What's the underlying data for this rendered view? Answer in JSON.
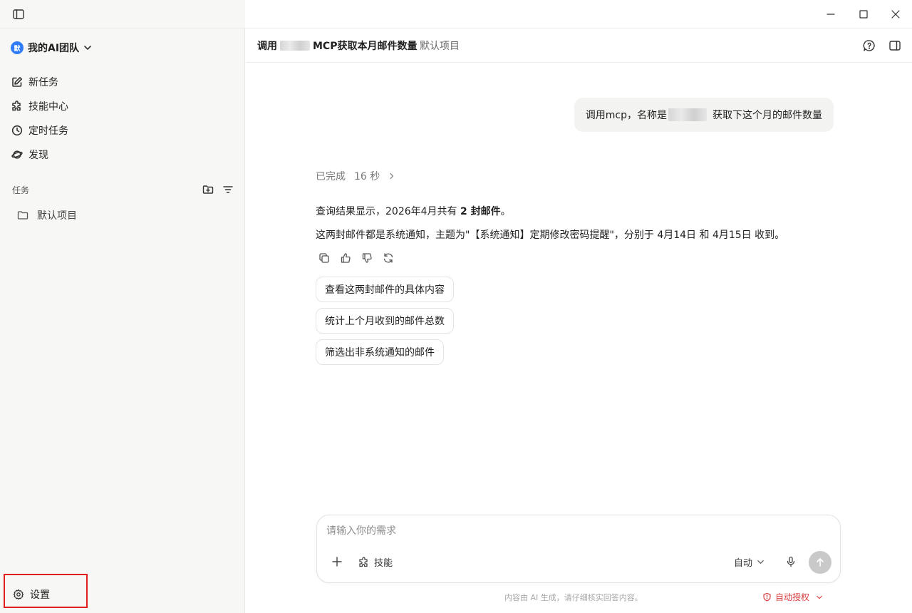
{
  "window": {
    "controls": [
      "sidebar-toggle-icon",
      "minimize-icon",
      "maximize-icon",
      "close-icon"
    ]
  },
  "sidebar": {
    "team_name": "我的AI团队",
    "team_avatar": "默",
    "nav": [
      {
        "label": "新任务",
        "icon": "edit-icon"
      },
      {
        "label": "技能中心",
        "icon": "puzzle-icon"
      },
      {
        "label": "定时任务",
        "icon": "clock-icon"
      },
      {
        "label": "发现",
        "icon": "planet-icon"
      }
    ],
    "section_label": "任务",
    "project_label": "默认项目",
    "settings_label": "设置"
  },
  "header": {
    "title_prefix": "调用",
    "title_suffix": "MCP获取本月邮件数量",
    "project": "默认项目"
  },
  "chat": {
    "user_message_prefix": "调用mcp，名称是",
    "user_message_suffix": "获取下这个月的邮件数量",
    "status_label": "已完成",
    "status_time": "16 秒",
    "answer1_prefix": "查询结果显示，2026年4月共有 ",
    "answer1_bold": "2 封邮件",
    "answer1_suffix": "。",
    "answer2": "这两封邮件都是系统通知，主题为\"【系统通知】定期修改密码提醒\"，分别于 4月14日 和 4月15日 收到。",
    "suggestions": [
      "查看这两封邮件的具体内容",
      "统计上个月收到的邮件总数",
      "筛选出非系统通知的邮件"
    ]
  },
  "composer": {
    "placeholder": "请输入你的需求",
    "skill_label": "技能",
    "mode_label": "自动"
  },
  "footer": {
    "note": "内容由 AI 生成，请仔细核实回答内容。",
    "auth_label": "自动授权"
  },
  "colors": {
    "accent": "#2f7cf6",
    "danger": "#d83b3b",
    "sidebar_bg": "#f7f7f5"
  }
}
